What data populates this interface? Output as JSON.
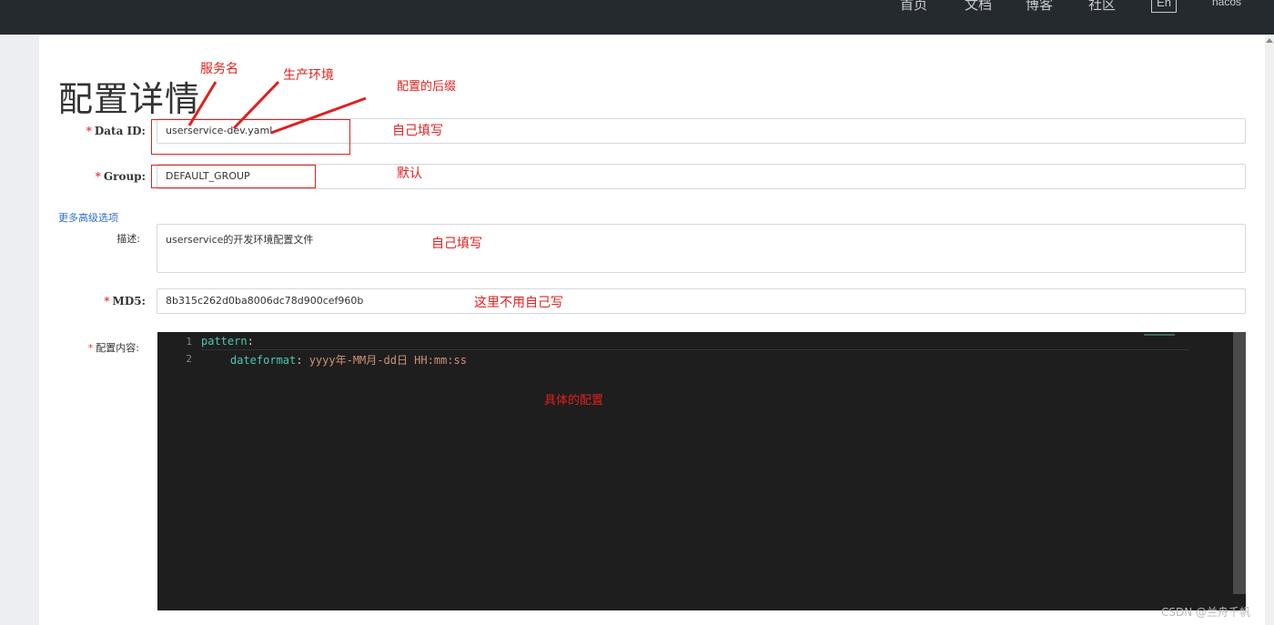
{
  "nav": {
    "items": [
      "首页",
      "文档",
      "博客",
      "社区"
    ],
    "lang": "En",
    "user": "nacos"
  },
  "page": {
    "title": "配置详情"
  },
  "form": {
    "data_id": {
      "label": "Data ID:",
      "value": "userservice-dev.yaml"
    },
    "group": {
      "label": "Group:",
      "value": "DEFAULT_GROUP"
    },
    "advanced_link": "更多高级选项",
    "description": {
      "label": "描述:",
      "value": "userservice的开发环境配置文件"
    },
    "md5": {
      "label": "MD5:",
      "value": "8b315c262d0ba8006dc78d900cef960b"
    },
    "content_label": "配置内容:"
  },
  "editor": {
    "lines": [
      {
        "num": "1",
        "key": "pattern",
        "punc": ":",
        "value": ""
      },
      {
        "num": "2",
        "key": "dateformat",
        "punc": ": ",
        "value": "yyyy年-MM月-dd日 HH:mm:ss"
      }
    ]
  },
  "annotations": {
    "service_name": "服务名",
    "profile": "生产环境",
    "suffix": "配置的后缀",
    "self_fill_1": "自己填写",
    "default": "默认",
    "self_fill_2": "自己填写",
    "no_need": "这里不用自己写",
    "specific": "具体的配置"
  },
  "colors": {
    "annotation": "#e0201e",
    "required": "#e33",
    "link": "#2f6ecc",
    "topbar": "#252a2f",
    "editor_bg": "#1e1e1e"
  },
  "watermark": "CSDN @兰舟千帆"
}
